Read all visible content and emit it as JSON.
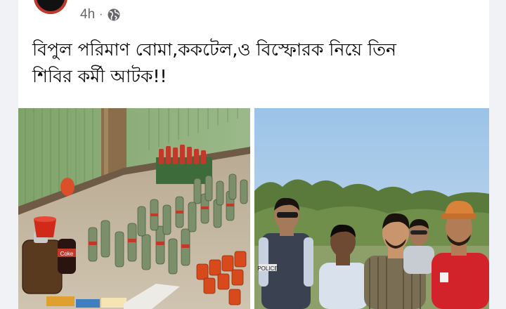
{
  "post": {
    "timestamp": "4h",
    "separator": "·",
    "audience_icon": "globe-icon",
    "text_line1": "বিপুল পরিমাণ বোমা,ককটেল,ও বিস্ফোরক নিয়ে তিন",
    "text_line2": "শিবির কর্মী আটক!!"
  },
  "media": {
    "left_photo": {
      "bottle_label": "Coke"
    },
    "right_photo": {
      "vest_text": "POLICE"
    }
  },
  "colors": {
    "text_primary": "#050505",
    "text_secondary": "#65676b",
    "card_bg": "#ffffff",
    "page_bg": "#f0f2f5"
  }
}
